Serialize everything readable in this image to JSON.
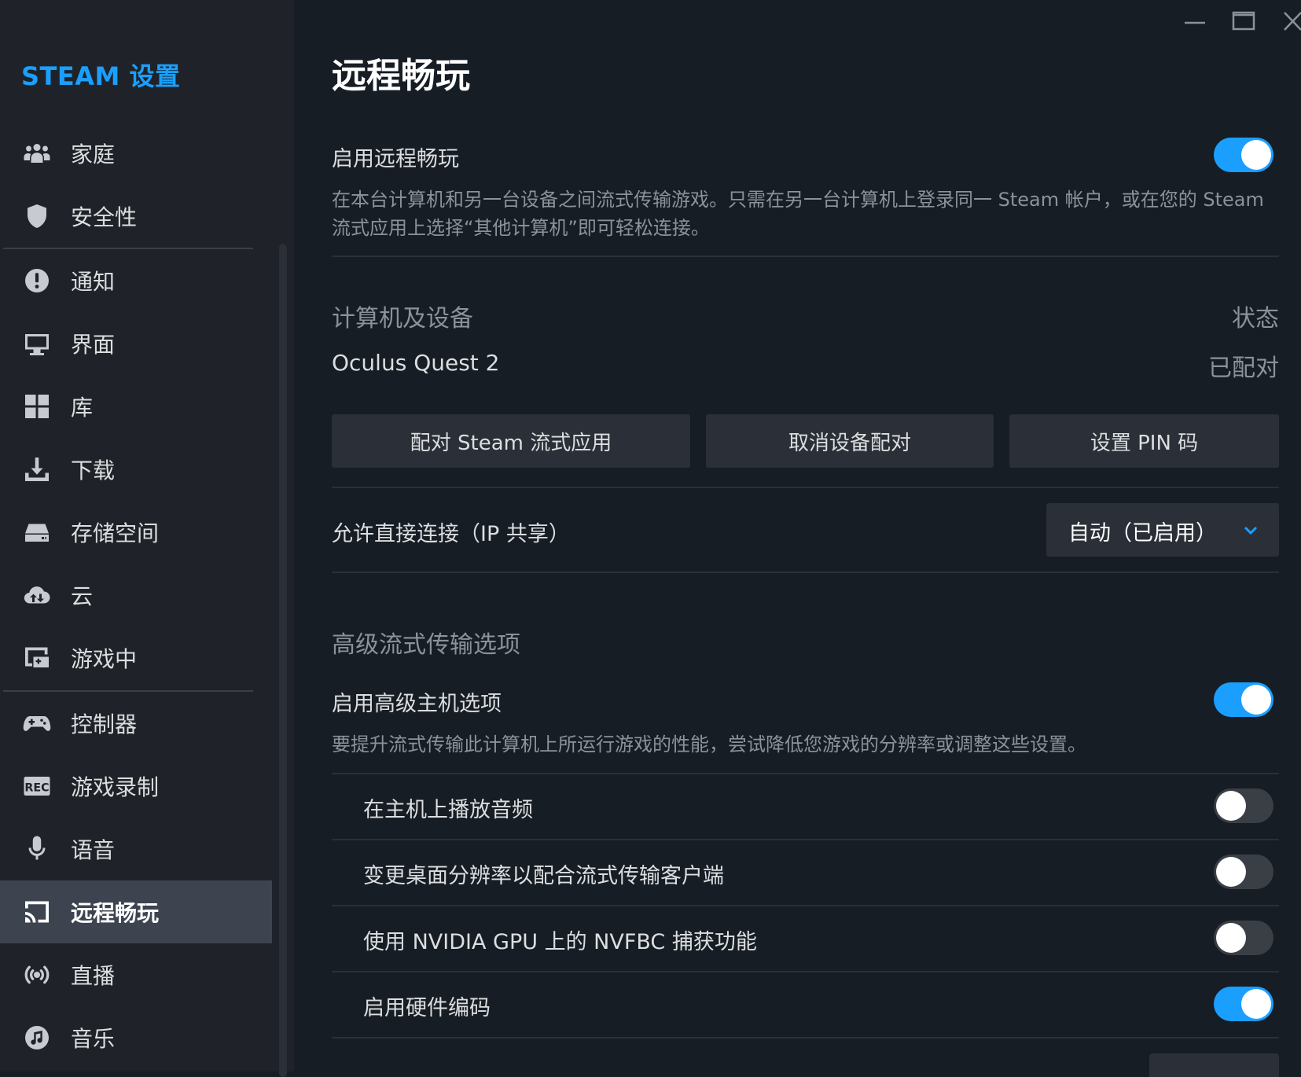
{
  "sidebar": {
    "title": "STEAM 设置",
    "items": [
      {
        "label": "家庭",
        "icon": "family-icon"
      },
      {
        "label": "安全性",
        "icon": "shield-icon"
      },
      {
        "label": "通知",
        "icon": "notification-icon"
      },
      {
        "label": "界面",
        "icon": "monitor-icon"
      },
      {
        "label": "库",
        "icon": "library-grid-icon"
      },
      {
        "label": "下载",
        "icon": "download-icon"
      },
      {
        "label": "存储空间",
        "icon": "storage-drive-icon"
      },
      {
        "label": "云",
        "icon": "cloud-icon"
      },
      {
        "label": "游戏中",
        "icon": "in-game-icon"
      },
      {
        "label": "控制器",
        "icon": "controller-icon"
      },
      {
        "label": "游戏录制",
        "icon": "rec-icon"
      },
      {
        "label": "语音",
        "icon": "microphone-icon"
      },
      {
        "label": "远程畅玩",
        "icon": "remote-play-icon",
        "active": true
      },
      {
        "label": "直播",
        "icon": "broadcast-icon"
      },
      {
        "label": "音乐",
        "icon": "music-icon"
      }
    ]
  },
  "main": {
    "title": "远程畅玩",
    "enable_remote_play": {
      "label": "启用远程畅玩",
      "on": true,
      "description": "在本台计算机和另一台设备之间流式传输游戏。只需在另一台计算机上登录同一 Steam 帐户，或在您的 Steam 流式应用上选择“其他计算机”即可轻松连接。"
    },
    "devices": {
      "header": "计算机及设备",
      "status_header": "状态",
      "device_name": "Oculus Quest 2",
      "device_status": "已配对",
      "buttons": [
        "配对 Steam 流式应用",
        "取消设备配对",
        "设置 PIN 码"
      ]
    },
    "direct_connect": {
      "label": "允许直接连接（IP 共享）",
      "value": "自动（已启用）"
    },
    "advanced": {
      "header": "高级流式传输选项",
      "host_options": {
        "label": "启用高级主机选项",
        "on": true,
        "description": "要提升流式传输此计算机上所运行游戏的性能，尝试降低您游戏的分辨率或调整这些设置。"
      },
      "options": [
        {
          "label": "在主机上播放音频",
          "on": false
        },
        {
          "label": "变更桌面分辨率以配合流式传输客户端",
          "on": false
        },
        {
          "label": "使用 NVIDIA GPU 上的 NVFBC 捕获功能",
          "on": false
        },
        {
          "label": "启用硬件编码",
          "on": true
        }
      ]
    }
  },
  "colors": {
    "accent": "#1a9fff",
    "background": "#171d25",
    "sidebar": "#1f2329"
  }
}
